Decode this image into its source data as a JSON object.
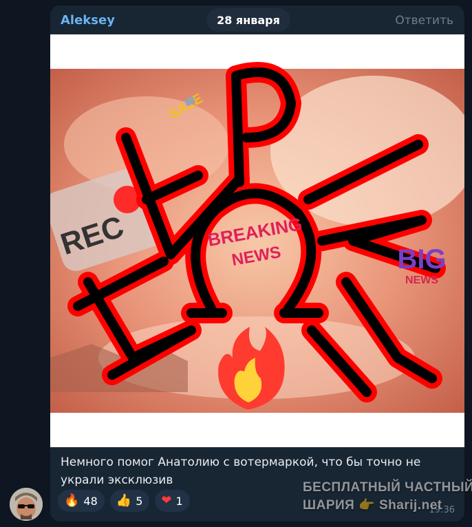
{
  "message": {
    "sender": "Aleksey",
    "date": "28 января",
    "reply_label": "Ответить",
    "caption": "Немного помог Анатолию с вотермаркой, что бы точно не украли эксклюзив",
    "time": "19:36"
  },
  "image": {
    "sale_label": "SALE",
    "rec_label": "REC",
    "breaking_label": "BREAKING",
    "news_label": "NEWS",
    "big_label": "BIG",
    "big_news_label": "NEWS",
    "logo_letters": "ЭКСПРЕСС"
  },
  "reactions": [
    {
      "emoji": "🔥",
      "icon": "fire-icon",
      "count": "48"
    },
    {
      "emoji": "👍",
      "icon": "thumbs-up-icon",
      "count": "5"
    },
    {
      "emoji": "❤",
      "icon": "heart-icon",
      "count": "1"
    }
  ],
  "watermark": {
    "line1": "БЕСПЛАТНЫЙ ЧАСТНЫЙ",
    "line2": "ШАРИЯ 👉 Sharij.net"
  },
  "colors": {
    "background": "#0e1621",
    "bubble": "#182533",
    "accent": "#6ab3f3",
    "reaction_bg": "#213246"
  }
}
